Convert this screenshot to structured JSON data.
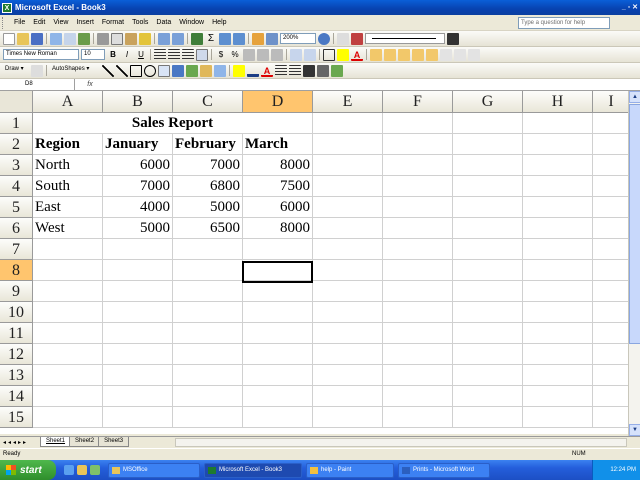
{
  "window": {
    "title": "Microsoft Excel - Book3",
    "controls": "_ ▫ ✕"
  },
  "menu": [
    "File",
    "Edit",
    "View",
    "Insert",
    "Format",
    "Tools",
    "Data",
    "Window",
    "Help"
  ],
  "help_placeholder": "Type a question for help",
  "toolbar_std": {
    "zoom": "200%"
  },
  "toolbar_fmt": {
    "font": "Times New Roman",
    "size": "10",
    "bold": "B",
    "italic": "I",
    "underline": "U",
    "currency": "$",
    "percent": "%"
  },
  "toolbar_draw": {
    "draw": "Draw ▾",
    "autoshapes": "AutoShapes ▾"
  },
  "formula_bar": {
    "name_box": "D8",
    "fx": "fx",
    "value": ""
  },
  "columns": [
    "A",
    "B",
    "C",
    "D",
    "E",
    "F",
    "G",
    "H",
    "I"
  ],
  "rows": [
    "1",
    "2",
    "3",
    "4",
    "5",
    "6",
    "7",
    "8",
    "9",
    "10",
    "11",
    "12",
    "13",
    "14",
    "15"
  ],
  "selected": {
    "column": "D",
    "row": "8"
  },
  "sheet_data": {
    "title": "Sales Report",
    "headers": [
      "Region",
      "January",
      "February",
      "March"
    ],
    "rows": [
      {
        "region": "North",
        "values": [
          "6000",
          "7000",
          "8000"
        ]
      },
      {
        "region": "South",
        "values": [
          "7000",
          "6800",
          "7500"
        ]
      },
      {
        "region": "East",
        "values": [
          "4000",
          "5000",
          "6000"
        ]
      },
      {
        "region": "West",
        "values": [
          "5000",
          "6500",
          "8000"
        ]
      }
    ]
  },
  "sheet_tabs": [
    "Sheet1",
    "Sheet2",
    "Sheet3"
  ],
  "status": {
    "left": "Ready",
    "num": "NUM"
  },
  "taskbar": {
    "start": "start",
    "tasks": [
      "MSOffice",
      "Microsoft Excel - Book3",
      "help - Paint",
      "Prints - Microsoft Word"
    ],
    "clock": "12:24 PM"
  },
  "colors": {
    "title_bar": "#0a5fd8",
    "selected_header": "#ffc56e",
    "taskbar": "#245edb",
    "start": "#2f8e2c"
  }
}
